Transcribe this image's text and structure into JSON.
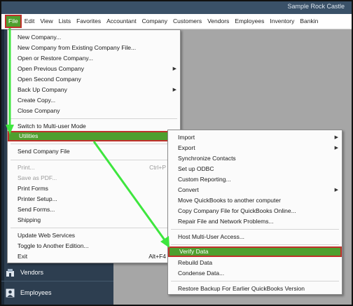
{
  "window": {
    "title": "Sample Rock Castle"
  },
  "menubar": {
    "items": [
      "File",
      "Edit",
      "View",
      "Lists",
      "Favorites",
      "Accountant",
      "Company",
      "Customers",
      "Vendors",
      "Employees",
      "Inventory",
      "Bankin"
    ]
  },
  "file_menu": {
    "items": [
      {
        "label": "New Company..."
      },
      {
        "label": "New Company from Existing Company File..."
      },
      {
        "label": "Open or Restore Company..."
      },
      {
        "label": "Open Previous Company",
        "submenu": true
      },
      {
        "label": "Open Second Company"
      },
      {
        "label": "Back Up Company",
        "submenu": true
      },
      {
        "label": "Create Copy..."
      },
      {
        "label": "Close Company"
      },
      {
        "label": "Switch to Multi-user Mode"
      },
      {
        "label": "Utilities",
        "submenu": true,
        "highlighted": true
      },
      {
        "label": "Send Company File",
        "submenu": true
      },
      {
        "label": "Print...",
        "shortcut": "Ctrl+P",
        "disabled": true
      },
      {
        "label": "Save as PDF...",
        "disabled": true
      },
      {
        "label": "Print Forms",
        "submenu": true
      },
      {
        "label": "Printer Setup..."
      },
      {
        "label": "Send Forms..."
      },
      {
        "label": "Shipping",
        "submenu": true
      },
      {
        "label": "Update Web Services"
      },
      {
        "label": "Toggle to Another Edition..."
      },
      {
        "label": "Exit",
        "shortcut": "Alt+F4"
      }
    ]
  },
  "utilities_menu": {
    "items": [
      {
        "label": "Import",
        "submenu": true
      },
      {
        "label": "Export",
        "submenu": true
      },
      {
        "label": "Synchronize Contacts"
      },
      {
        "label": "Set up ODBC"
      },
      {
        "label": "Custom Reporting..."
      },
      {
        "label": "Convert",
        "submenu": true
      },
      {
        "label": "Move QuickBooks to another computer"
      },
      {
        "label": "Copy Company File for QuickBooks Online..."
      },
      {
        "label": "Repair File and Network Problems..."
      },
      {
        "label": "Host Multi-User Access..."
      },
      {
        "label": "Verify Data",
        "highlighted": true
      },
      {
        "label": "Rebuild Data"
      },
      {
        "label": "Condense Data..."
      },
      {
        "label": "Restore Backup For Earlier QuickBooks Version"
      }
    ]
  },
  "sidebar": {
    "items": [
      {
        "label": "Vendors",
        "icon": "vendors-icon"
      },
      {
        "label": "Employees",
        "icon": "employees-icon"
      }
    ]
  },
  "colors": {
    "highlight": "#4f9f2e",
    "highlight_border": "#c0302b",
    "sidebar": "#2d3e50",
    "annotation_arrow": "#3ee63e"
  }
}
